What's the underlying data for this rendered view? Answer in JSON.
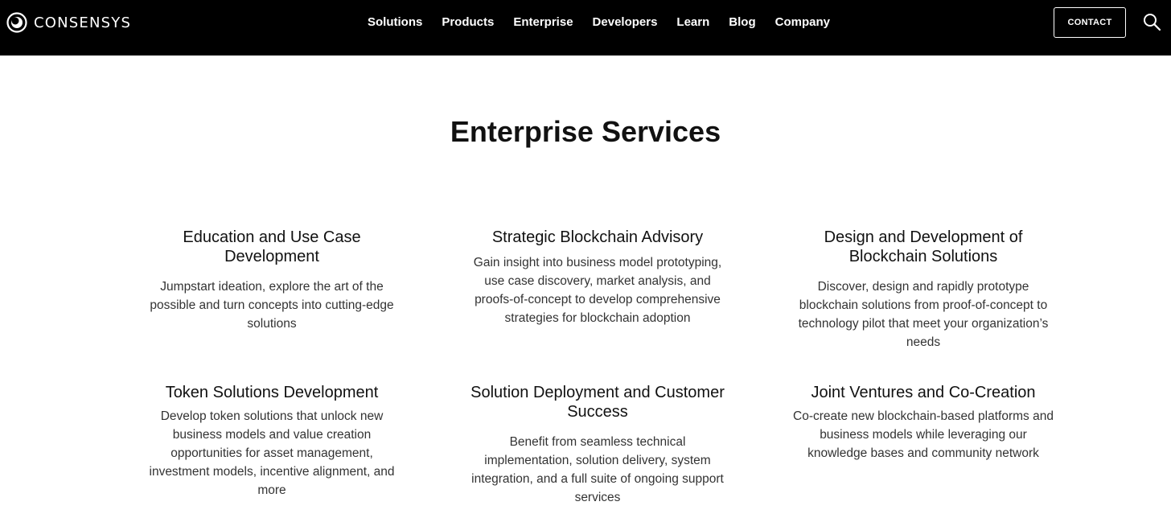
{
  "brand": {
    "name": "CONSENSYS",
    "logo_icon": "consensys-logo-icon"
  },
  "nav": {
    "items": [
      {
        "label": "Solutions"
      },
      {
        "label": "Products"
      },
      {
        "label": "Enterprise"
      },
      {
        "label": "Developers"
      },
      {
        "label": "Learn"
      },
      {
        "label": "Blog"
      },
      {
        "label": "Company"
      }
    ],
    "contact_label": "CONTACT",
    "search_icon": "search-icon"
  },
  "main": {
    "title": "Enterprise Services",
    "cards": [
      {
        "title": "Education and Use Case Development",
        "desc": "Jumpstart ideation, explore the art of the possible and turn concepts into cutting-edge solutions"
      },
      {
        "title": "Strategic Blockchain Advisory",
        "desc": "Gain insight into business model prototyping, use case discovery, market analysis, and proofs-of-concept to develop comprehensive strategies for blockchain adoption"
      },
      {
        "title": "Design and Development of Blockchain Solutions",
        "desc": "Discover, design and rapidly prototype blockchain solutions from proof-of-concept to technology pilot that meet your organization’s needs"
      },
      {
        "title": "Token Solutions Development",
        "desc": "Develop token solutions that unlock new business models and value creation opportunities for asset management, investment models, incentive alignment, and more"
      },
      {
        "title": "Solution Deployment and Customer Success",
        "desc": "Benefit from seamless technical implementation, solution delivery, system integration, and a full suite of ongoing support services"
      },
      {
        "title": "Joint Ventures and Co-Creation",
        "desc": "Co-create new blockchain-based platforms and business models while leveraging our knowledge bases and community network"
      }
    ]
  },
  "colors": {
    "header_bg": "#000000",
    "page_bg": "#ffffff",
    "text": "#111111"
  }
}
